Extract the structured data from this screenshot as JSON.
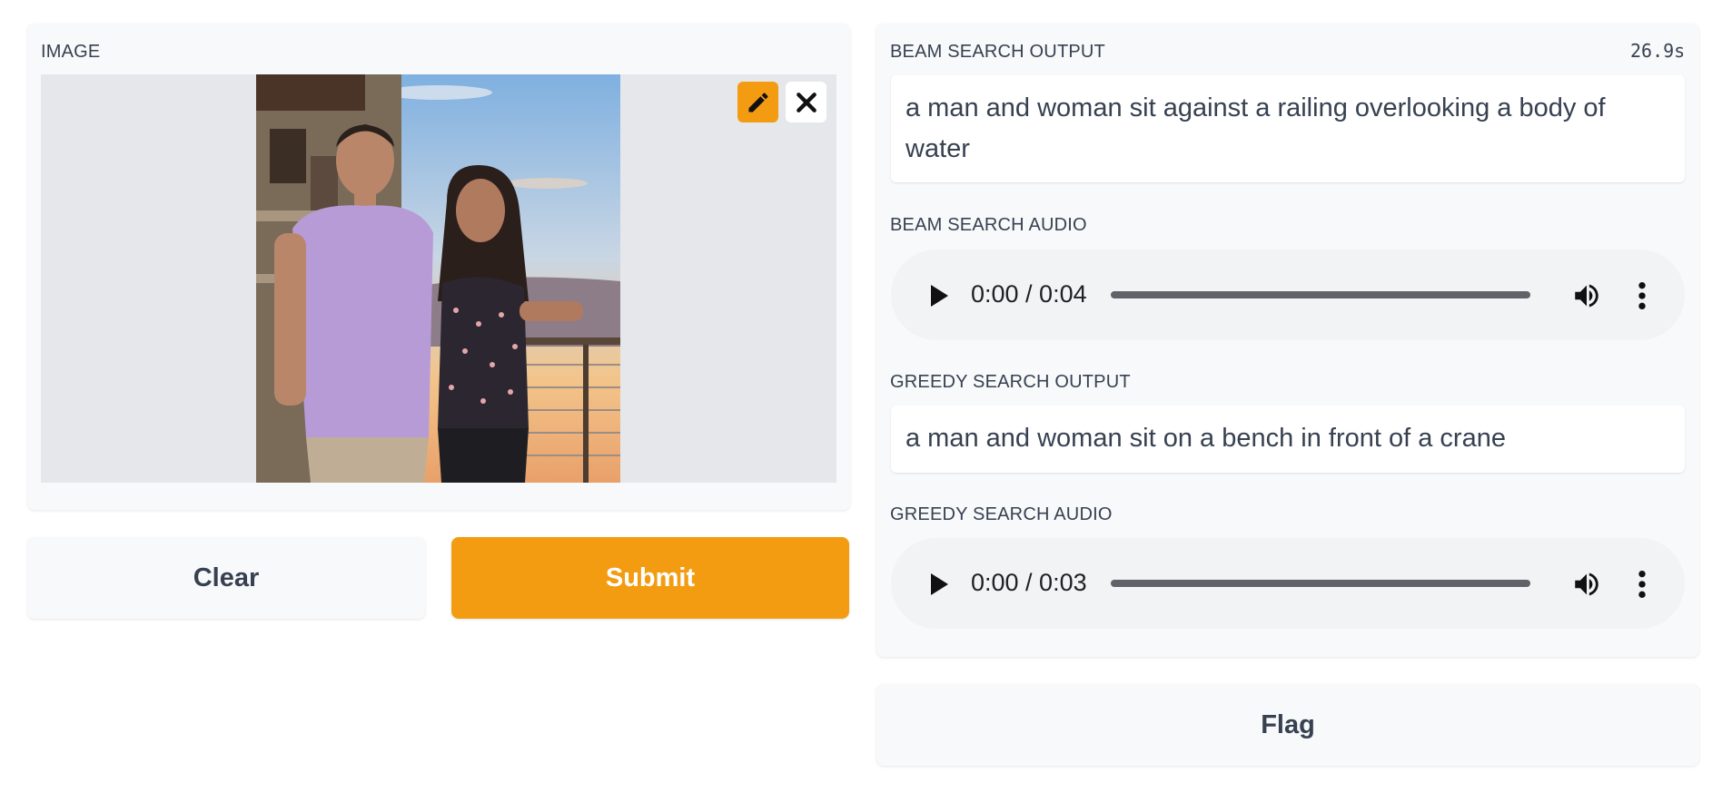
{
  "input_panel": {
    "label": "IMAGE",
    "edit_icon": "pencil-icon",
    "clear_icon": "close-icon"
  },
  "buttons": {
    "clear": "Clear",
    "submit": "Submit",
    "flag": "Flag"
  },
  "output_panel": {
    "timer": "26.9s",
    "beam_output_label": "BEAM SEARCH OUTPUT",
    "beam_output_text": "a man and woman sit against a railing overlooking a body of water",
    "beam_audio_label": "BEAM SEARCH AUDIO",
    "beam_audio_time": "0:00 / 0:04",
    "greedy_output_label": "GREEDY SEARCH OUTPUT",
    "greedy_output_text": "a man and woman sit on a bench in front of a crane",
    "greedy_audio_label": "GREEDY SEARCH AUDIO",
    "greedy_audio_time": "0:00 / 0:03"
  },
  "colors": {
    "accent": "#f39c12",
    "panel_bg": "#f8f9fa",
    "image_bg": "#e5e7eb",
    "audio_bg": "#f1f3f4"
  }
}
